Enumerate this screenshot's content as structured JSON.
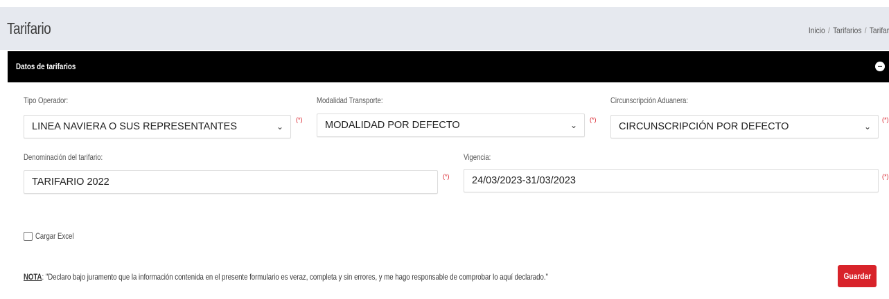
{
  "header": {
    "title": "Tarifario",
    "breadcrumb": [
      "Inicio",
      "Tarifarios",
      "Tarifari"
    ],
    "breadcrumb_separator": "/"
  },
  "card": {
    "title": "Datos de tarifarios",
    "collapse_icon": "minus-circle-icon"
  },
  "form": {
    "tipo_operador": {
      "label": "Tipo Operador:",
      "value": "LINEA NAVIERA O SUS REPRESENTANTES",
      "required_mark": "(*)"
    },
    "modalidad_transporte": {
      "label": "Modalidad Transporte:",
      "value": "MODALIDAD POR DEFECTO",
      "required_mark": "(*)"
    },
    "circunscripcion": {
      "label": "Circunscripción Aduanera:",
      "value": "CIRCUNSCRIPCIÓN POR DEFECTO",
      "required_mark": "(*)"
    },
    "denominacion": {
      "label": "Denominación del tarifario:",
      "value": "TARIFARIO 2022",
      "required_mark": "(*)"
    },
    "vigencia": {
      "label": "Vigencia:",
      "value": "24/03/2023-31/03/2023",
      "required_mark": "(*)"
    },
    "cargar_excel": {
      "label": "Cargar Excel",
      "checked": false
    }
  },
  "note": {
    "prefix": "NOTA",
    "text": ": \"Declaro bajo juramento que la información contenida en el presente formulario es veraz, completa y sin errores, y me hago responsable de comprobar lo aquí declarado.\""
  },
  "actions": {
    "save_label": "Guardar"
  },
  "colors": {
    "header_bg": "#e6e9ef",
    "card_header_bg": "#000000",
    "required": "#d9232d",
    "save_button": "#d8232a"
  }
}
